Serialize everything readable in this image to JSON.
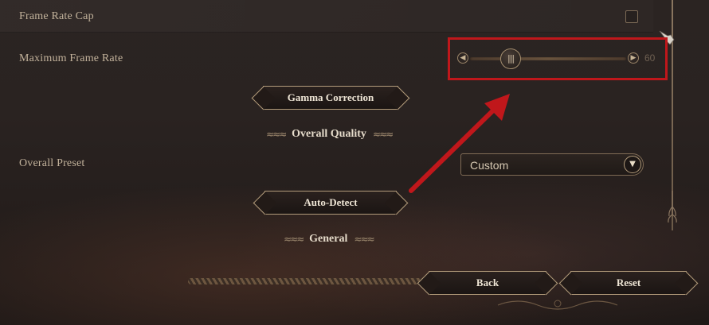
{
  "rows": {
    "frame_rate_cap": {
      "label": "Frame Rate Cap",
      "checked": false
    },
    "max_frame_rate": {
      "label": "Maximum Frame Rate",
      "value": "60"
    },
    "overall_preset": {
      "label": "Overall Preset",
      "value": "Custom"
    }
  },
  "buttons": {
    "gamma": "Gamma Correction",
    "auto_detect": "Auto-Detect",
    "back": "Back",
    "reset": "Reset"
  },
  "sections": {
    "overall_quality": "Overall Quality",
    "general": "General"
  },
  "icons": {
    "slider_thumb": "grip-lines-icon",
    "slider_left": "chevron-left-icon",
    "slider_right": "chevron-right-icon",
    "dropdown": "chevron-down-icon",
    "cursor": "gauntlet-cursor-icon"
  },
  "colors": {
    "highlight": "#c0171b",
    "accent_gold": "#b39c7b",
    "text": "#c2b29b"
  }
}
